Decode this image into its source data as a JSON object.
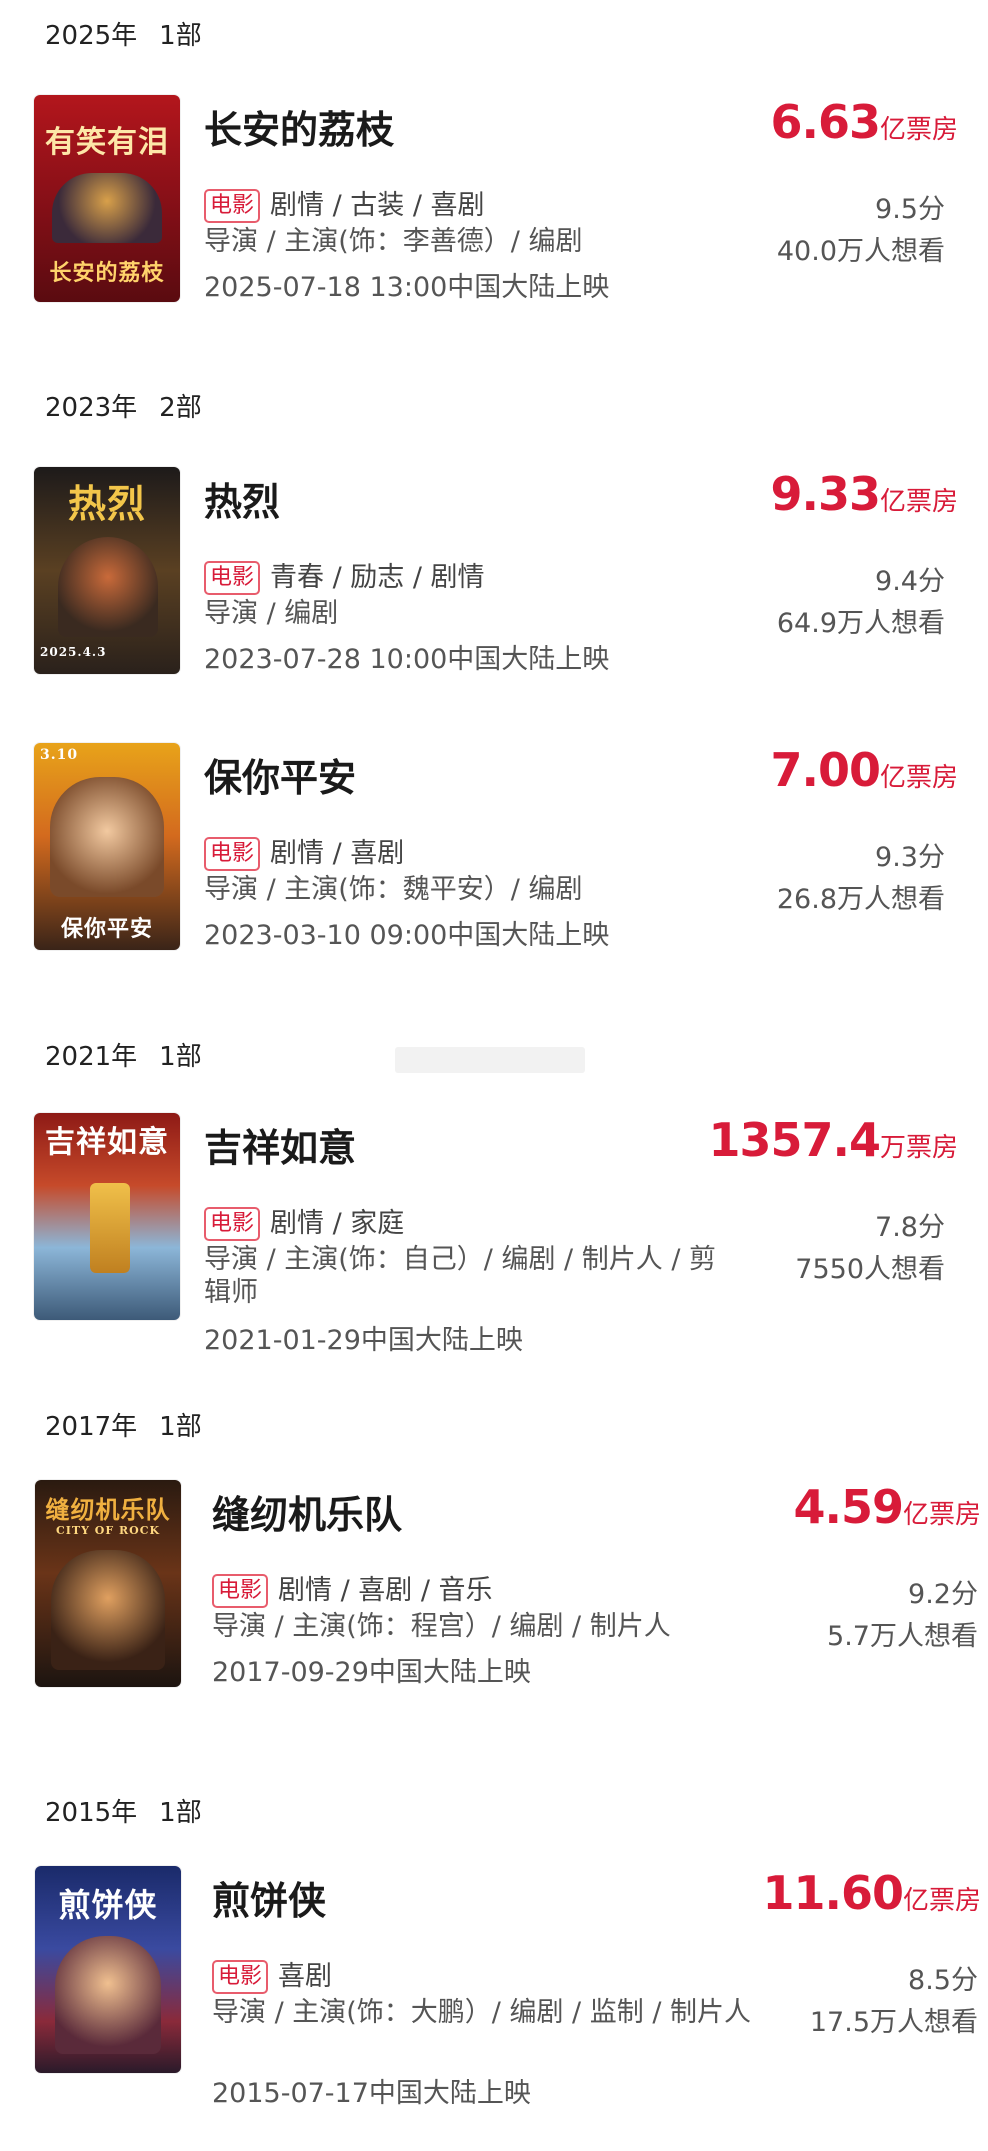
{
  "groups": [
    {
      "year": "2025年",
      "count": "1部"
    },
    {
      "year": "2023年",
      "count": "2部"
    },
    {
      "year": "2021年",
      "count": "1部"
    },
    {
      "year": "2017年",
      "count": "1部"
    },
    {
      "year": "2015年",
      "count": "1部"
    }
  ],
  "movies": [
    {
      "title": "长安的荔枝",
      "box_number": "6.63",
      "box_unit": "亿票房",
      "tag": "电影",
      "genres": "剧情 / 古装 / 喜剧",
      "roles": "导演 / 主演(饰：李善德）/ 编剧",
      "release": "2025-07-18 13:00中国大陆上映",
      "score": "9.5分",
      "want": "40.0万人想看",
      "poster_top_text": "有笑有泪",
      "poster_bottom_text": "长安的荔枝"
    },
    {
      "title": "热烈",
      "box_number": "9.33",
      "box_unit": "亿票房",
      "tag": "电影",
      "genres": "青春 / 励志 / 剧情",
      "roles": "导演 / 编剧",
      "release": "2023-07-28 10:00中国大陆上映",
      "score": "9.4分",
      "want": "64.9万人想看",
      "poster_top_text": "热烈",
      "poster_bottom_text": "2025.4.3"
    },
    {
      "title": "保你平安",
      "box_number": "7.00",
      "box_unit": "亿票房",
      "tag": "电影",
      "genres": "剧情 / 喜剧",
      "roles": "导演 / 主演(饰：魏平安）/ 编剧",
      "release": "2023-03-10 09:00中国大陆上映",
      "score": "9.3分",
      "want": "26.8万人想看",
      "poster_top_text": "3.10",
      "poster_bottom_text": "保你平安"
    },
    {
      "title": "吉祥如意",
      "box_number": "1357.4",
      "box_unit": "万票房",
      "tag": "电影",
      "genres": "剧情 / 家庭",
      "roles": "导演 / 主演(饰：自己）/ 编剧 / 制片人 / 剪辑师",
      "release": "2021-01-29中国大陆上映",
      "score": "7.8分",
      "want": "7550人想看",
      "poster_top_text": "吉祥如意",
      "poster_bottom_text": ""
    },
    {
      "title": "缝纫机乐队",
      "box_number": "4.59",
      "box_unit": "亿票房",
      "tag": "电影",
      "genres": "剧情 / 喜剧 / 音乐",
      "roles": "导演 / 主演(饰：程宫）/ 编剧 / 制片人",
      "release": "2017-09-29中国大陆上映",
      "score": "9.2分",
      "want": "5.7万人想看",
      "poster_top_text": "缝纫机乐队",
      "poster_bottom_text": "CITY OF ROCK"
    },
    {
      "title": "煎饼侠",
      "box_number": "11.60",
      "box_unit": "亿票房",
      "tag": "电影",
      "genres": "喜剧",
      "roles": "导演 / 主演(饰：大鹏）/ 编剧 / 监制 / 制片人",
      "release": "2015-07-17中国大陆上映",
      "score": "8.5分",
      "want": "17.5万人想看",
      "poster_top_text": "煎饼侠",
      "poster_bottom_text": ""
    }
  ],
  "colors": {
    "accent_red": "#d81b39",
    "text_dark": "#1a1a1a",
    "text_gray": "#555555"
  }
}
